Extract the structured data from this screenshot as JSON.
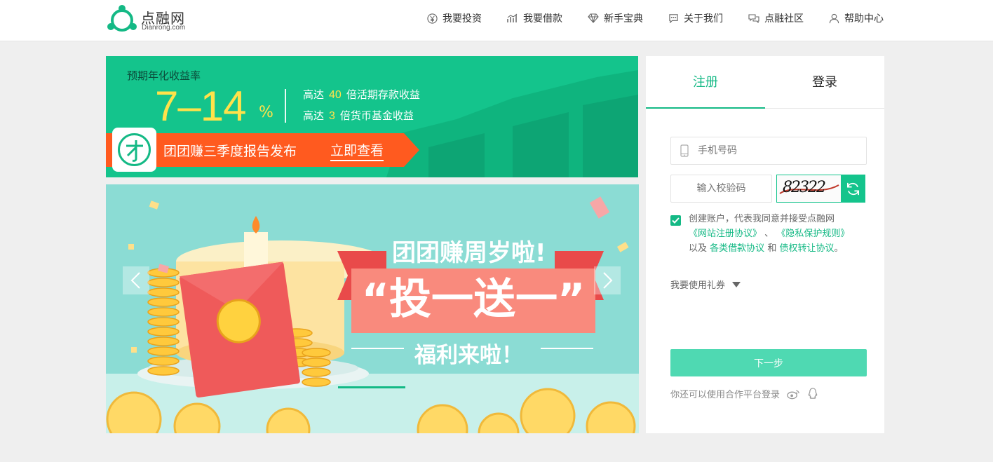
{
  "header": {
    "logo_cn": "点融网",
    "logo_en": "Dianrong.com",
    "nav": [
      {
        "label": "我要投资",
        "icon": "yen-icon"
      },
      {
        "label": "我要借款",
        "icon": "chart-icon"
      },
      {
        "label": "新手宝典",
        "icon": "diamond-icon"
      },
      {
        "label": "关于我们",
        "icon": "chat-icon"
      },
      {
        "label": "点融社区",
        "icon": "community-icon"
      },
      {
        "label": "帮助中心",
        "icon": "user-icon"
      }
    ]
  },
  "top_banner": {
    "label": "预期年化收益率",
    "rate": "7–14",
    "pct": "%",
    "line1_prefix": "高达",
    "line1_num": "40",
    "line1_suffix": "倍活期存款收益",
    "line2_prefix": "高达",
    "line2_num": "3",
    "line2_suffix": "倍货币基金收益",
    "ribbon_text": "团团赚三季度报告发布",
    "ribbon_link": "立即查看",
    "accent": "#14c48c"
  },
  "carousel": {
    "title": "团团赚周岁啦!",
    "big_text": "“投一送一”",
    "sub_text": "福利来啦！"
  },
  "auth": {
    "tab_register": "注册",
    "tab_login": "登录",
    "phone_placeholder": "手机号码",
    "code_placeholder": "输入校验码",
    "captcha": "82322",
    "agree_prefix": "创建账户，代表我同意并接受点融网",
    "agree_link1": "《网站注册协议》",
    "agree_sep": "、",
    "agree_link2": "《隐私保护规则》",
    "agree_mid": "以及",
    "agree_link3": "各类借款协议",
    "agree_and": "和",
    "agree_link4": "债权转让协议",
    "agree_end": "。",
    "coupon": "我要使用礼券",
    "next_button": "下一步",
    "partner_text": "你还可以使用合作平台登录",
    "accent": "#14b985"
  }
}
